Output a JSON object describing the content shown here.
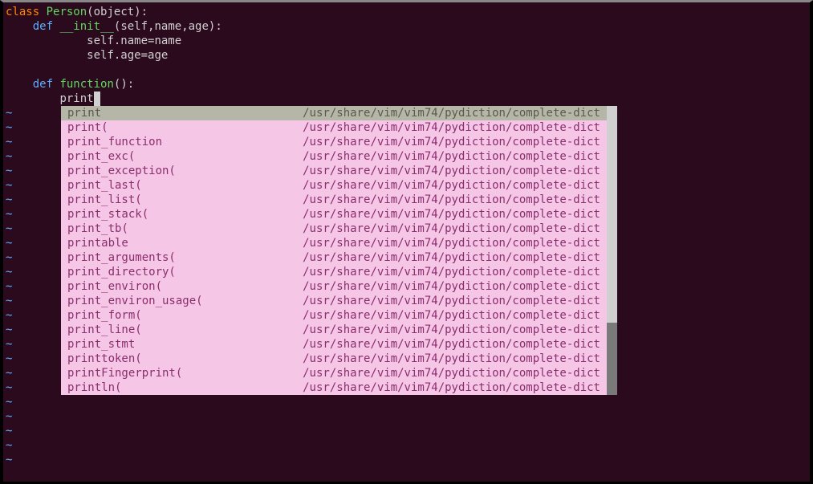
{
  "code": {
    "line1": {
      "kw": "class",
      "sp1": " ",
      "name": "Person",
      "rest": "(object):"
    },
    "line2": {
      "indent": "    ",
      "kw": "def",
      "sp1": " ",
      "name": "__init__",
      "rest": "(self,name,age):"
    },
    "line3": {
      "indent": "            ",
      "text": "self.name=name"
    },
    "line4": {
      "indent": "            ",
      "text": "self.age=age"
    },
    "line5": "",
    "line6": {
      "indent": "    ",
      "kw": "def",
      "sp1": " ",
      "name": "function",
      "rest": "():"
    },
    "line7": {
      "indent": "        ",
      "text": "print"
    }
  },
  "popup": {
    "items": [
      {
        "name": "print",
        "path": "/usr/share/vim/vim74/pydiction/complete-dict",
        "selected": true
      },
      {
        "name": "print(",
        "path": "/usr/share/vim/vim74/pydiction/complete-dict"
      },
      {
        "name": "print_function",
        "path": "/usr/share/vim/vim74/pydiction/complete-dict"
      },
      {
        "name": "print_exc(",
        "path": "/usr/share/vim/vim74/pydiction/complete-dict"
      },
      {
        "name": "print_exception(",
        "path": "/usr/share/vim/vim74/pydiction/complete-dict"
      },
      {
        "name": "print_last(",
        "path": "/usr/share/vim/vim74/pydiction/complete-dict"
      },
      {
        "name": "print_list(",
        "path": "/usr/share/vim/vim74/pydiction/complete-dict"
      },
      {
        "name": "print_stack(",
        "path": "/usr/share/vim/vim74/pydiction/complete-dict"
      },
      {
        "name": "print_tb(",
        "path": "/usr/share/vim/vim74/pydiction/complete-dict"
      },
      {
        "name": "printable",
        "path": "/usr/share/vim/vim74/pydiction/complete-dict"
      },
      {
        "name": "print_arguments(",
        "path": "/usr/share/vim/vim74/pydiction/complete-dict"
      },
      {
        "name": "print_directory(",
        "path": "/usr/share/vim/vim74/pydiction/complete-dict"
      },
      {
        "name": "print_environ(",
        "path": "/usr/share/vim/vim74/pydiction/complete-dict"
      },
      {
        "name": "print_environ_usage(",
        "path": "/usr/share/vim/vim74/pydiction/complete-dict"
      },
      {
        "name": "print_form(",
        "path": "/usr/share/vim/vim74/pydiction/complete-dict"
      },
      {
        "name": "print_line(",
        "path": "/usr/share/vim/vim74/pydiction/complete-dict"
      },
      {
        "name": "print_stmt",
        "path": "/usr/share/vim/vim74/pydiction/complete-dict"
      },
      {
        "name": "printtoken(",
        "path": "/usr/share/vim/vim74/pydiction/complete-dict"
      },
      {
        "name": "printFingerprint(",
        "path": "/usr/share/vim/vim74/pydiction/complete-dict"
      },
      {
        "name": "println(",
        "path": "/usr/share/vim/vim74/pydiction/complete-dict"
      }
    ]
  },
  "tilde": "~",
  "tilde_count_behind": 20,
  "tilde_count_below": 5
}
